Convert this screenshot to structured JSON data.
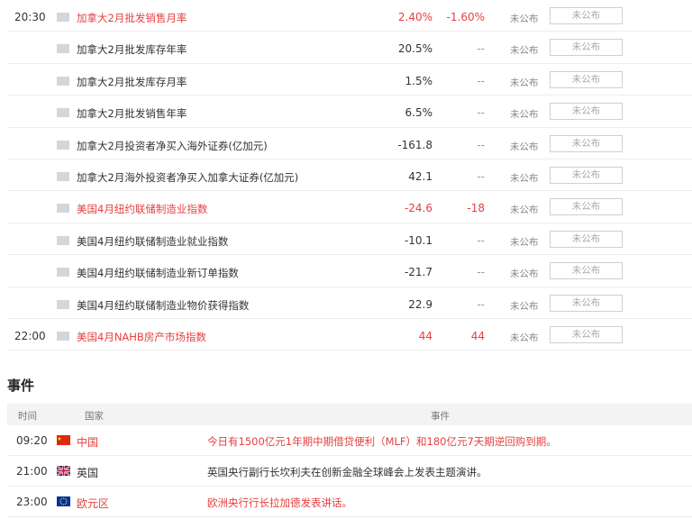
{
  "data_rows": [
    {
      "time": "20:30",
      "name": "加拿大2月批发销售月率",
      "prev": "2.40%",
      "consensus": "-1.60%",
      "actual": "未公布",
      "action": "未公布",
      "highlight": true
    },
    {
      "time": "",
      "name": "加拿大2月批发库存年率",
      "prev": "20.5%",
      "consensus": "--",
      "actual": "未公布",
      "action": "未公布",
      "highlight": false
    },
    {
      "time": "",
      "name": "加拿大2月批发库存月率",
      "prev": "1.5%",
      "consensus": "--",
      "actual": "未公布",
      "action": "未公布",
      "highlight": false
    },
    {
      "time": "",
      "name": "加拿大2月批发销售年率",
      "prev": "6.5%",
      "consensus": "--",
      "actual": "未公布",
      "action": "未公布",
      "highlight": false
    },
    {
      "time": "",
      "name": "加拿大2月投资者净买入海外证券(亿加元)",
      "prev": "-161.8",
      "consensus": "--",
      "actual": "未公布",
      "action": "未公布",
      "highlight": false
    },
    {
      "time": "",
      "name": "加拿大2月海外投资者净买入加拿大证券(亿加元)",
      "prev": "42.1",
      "consensus": "--",
      "actual": "未公布",
      "action": "未公布",
      "highlight": false
    },
    {
      "time": "",
      "name": "美国4月纽约联储制造业指数",
      "prev": "-24.6",
      "consensus": "-18",
      "actual": "未公布",
      "action": "未公布",
      "highlight": true
    },
    {
      "time": "",
      "name": "美国4月纽约联储制造业就业指数",
      "prev": "-10.1",
      "consensus": "--",
      "actual": "未公布",
      "action": "未公布",
      "highlight": false
    },
    {
      "time": "",
      "name": "美国4月纽约联储制造业新订单指数",
      "prev": "-21.7",
      "consensus": "--",
      "actual": "未公布",
      "action": "未公布",
      "highlight": false
    },
    {
      "time": "",
      "name": "美国4月纽约联储制造业物价获得指数",
      "prev": "22.9",
      "consensus": "--",
      "actual": "未公布",
      "action": "未公布",
      "highlight": false
    },
    {
      "time": "22:00",
      "name": "美国4月NAHB房产市场指数",
      "prev": "44",
      "consensus": "44",
      "actual": "未公布",
      "action": "未公布",
      "highlight": true
    }
  ],
  "events": {
    "title": "事件",
    "headers": {
      "time": "时间",
      "country": "国家",
      "event": "事件"
    },
    "rows": [
      {
        "time": "09:20",
        "country": "中国",
        "flag": "china-flag-icon",
        "text": "今日有1500亿元1年期中期借贷便利（MLF）和180亿元7天期逆回购到期。",
        "highlight": true
      },
      {
        "time": "21:00",
        "country": "英国",
        "flag": "uk-flag-icon",
        "text": "英国央行副行长坎利夫在创新金融全球峰会上发表主题演讲。",
        "highlight": false
      },
      {
        "time": "23:00",
        "country": "欧元区",
        "flag": "eu-flag-icon",
        "text": "欧洲央行行长拉加德发表讲话。",
        "highlight": true
      }
    ]
  },
  "colors": {
    "highlight": "#e63f3f",
    "header_bg": "#f2f3f5",
    "border": "#ededed"
  }
}
